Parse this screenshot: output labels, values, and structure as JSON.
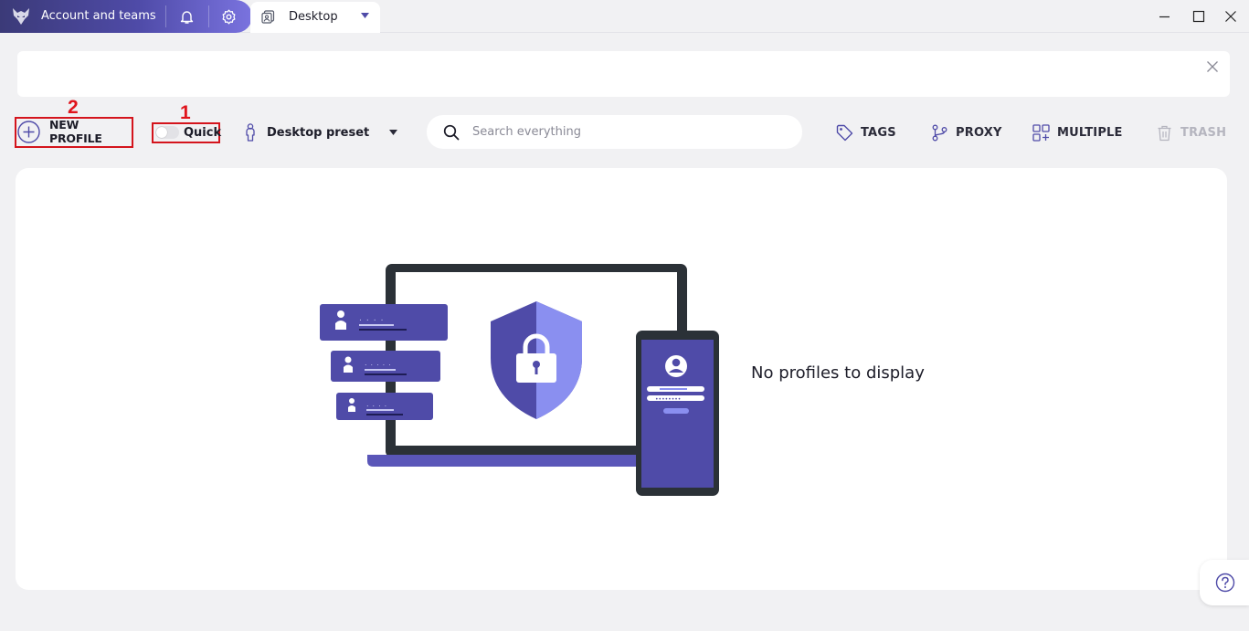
{
  "titlebar": {
    "account_title": "Account and teams",
    "tab_label": "Desktop",
    "icons": [
      "wolf-logo",
      "bell-icon",
      "gear-icon",
      "profile-tab-icon",
      "chevron-down-icon",
      "minimize-icon",
      "maximize-icon",
      "close-icon"
    ]
  },
  "annotations": {
    "step_1": "1",
    "step_2": "2",
    "highlight_color": "#d4141c"
  },
  "toolbar": {
    "new_profile_label": "NEW PROFILE",
    "quick_label": "Quick",
    "quick_enabled": false,
    "preset_label": "Desktop preset",
    "search_placeholder": "Search everything",
    "search_value": "",
    "tags_label": "TAGS",
    "proxy_label": "PROXY",
    "multiple_label": "MULTIPLE",
    "trash_label": "TRASH"
  },
  "main": {
    "empty_message": "No profiles to display"
  },
  "colors": {
    "accent": "#4f4ba8",
    "accent_light": "#8a8ff0",
    "dark": "#2b3137",
    "background": "#f1f1f3"
  }
}
